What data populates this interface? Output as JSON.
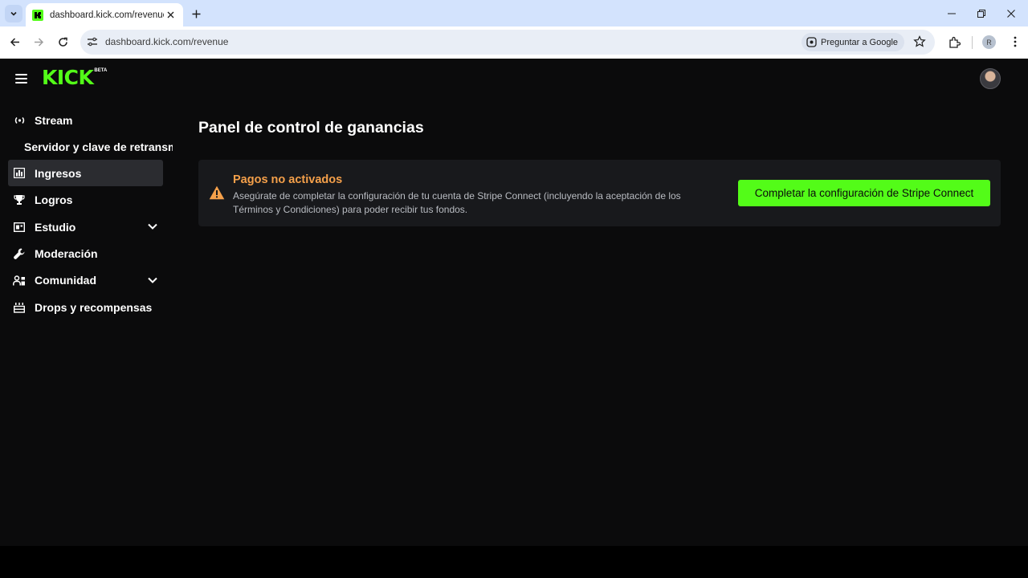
{
  "browser": {
    "tab_title": "dashboard.kick.com/revenue",
    "url": "dashboard.kick.com/revenue",
    "ask_google_label": "Preguntar a Google",
    "profile_initial": "R"
  },
  "header": {
    "logo_text": "KICK",
    "logo_badge": "BETA",
    "brand_color": "#53fc18"
  },
  "sidebar": {
    "items": [
      {
        "label": "Stream",
        "icon": "broadcast-icon"
      },
      {
        "label": "Servidor y clave de retransm",
        "sub": true
      },
      {
        "label": "Ingresos",
        "icon": "chart-icon",
        "active": true
      },
      {
        "label": "Logros",
        "icon": "trophy-icon"
      },
      {
        "label": "Estudio",
        "icon": "studio-icon",
        "expandable": true
      },
      {
        "label": "Moderación",
        "icon": "wrench-icon"
      },
      {
        "label": "Comunidad",
        "icon": "community-icon",
        "expandable": true
      },
      {
        "label": "Drops y recompensas",
        "icon": "gift-icon"
      }
    ]
  },
  "main": {
    "title": "Panel de control de ganancias",
    "alert": {
      "title": "Pagos no activados",
      "body": "Asegúrate de completar la configuración de tu cuenta de Stripe Connect (incluyendo la aceptación de los Términos y Condiciones) para poder recibir tus fondos.",
      "button_label": "Completar la configuración de Stripe Connect",
      "title_color": "#f5a04a"
    }
  }
}
